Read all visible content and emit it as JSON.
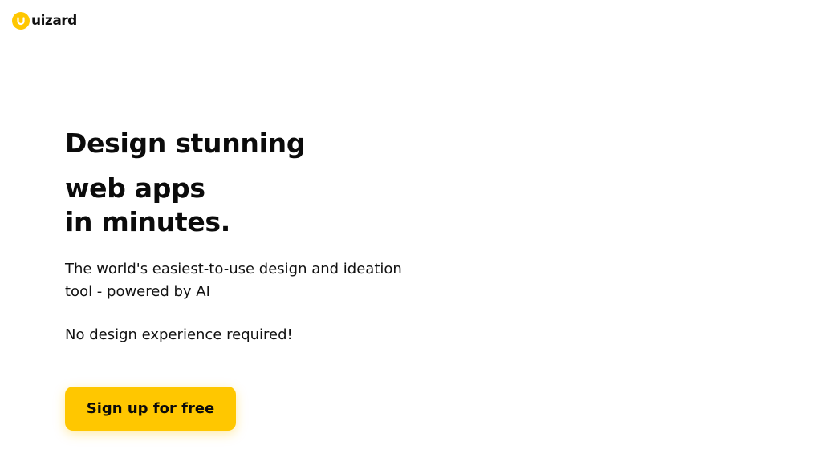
{
  "header": {
    "logo_text": "uizard",
    "logo_color": "#FFC700"
  },
  "hero": {
    "headline_line1": "Design stunning",
    "headline_line2": "web apps",
    "headline_line3": "in minutes.",
    "subtitle": "The world's easiest-to-use design and ideation tool - powered by AI",
    "note": "No design experience required!",
    "cta_label": "Sign up for free"
  },
  "colors": {
    "accent": "#FFC700",
    "text": "#0b0b0b",
    "background": "#ffffff"
  }
}
